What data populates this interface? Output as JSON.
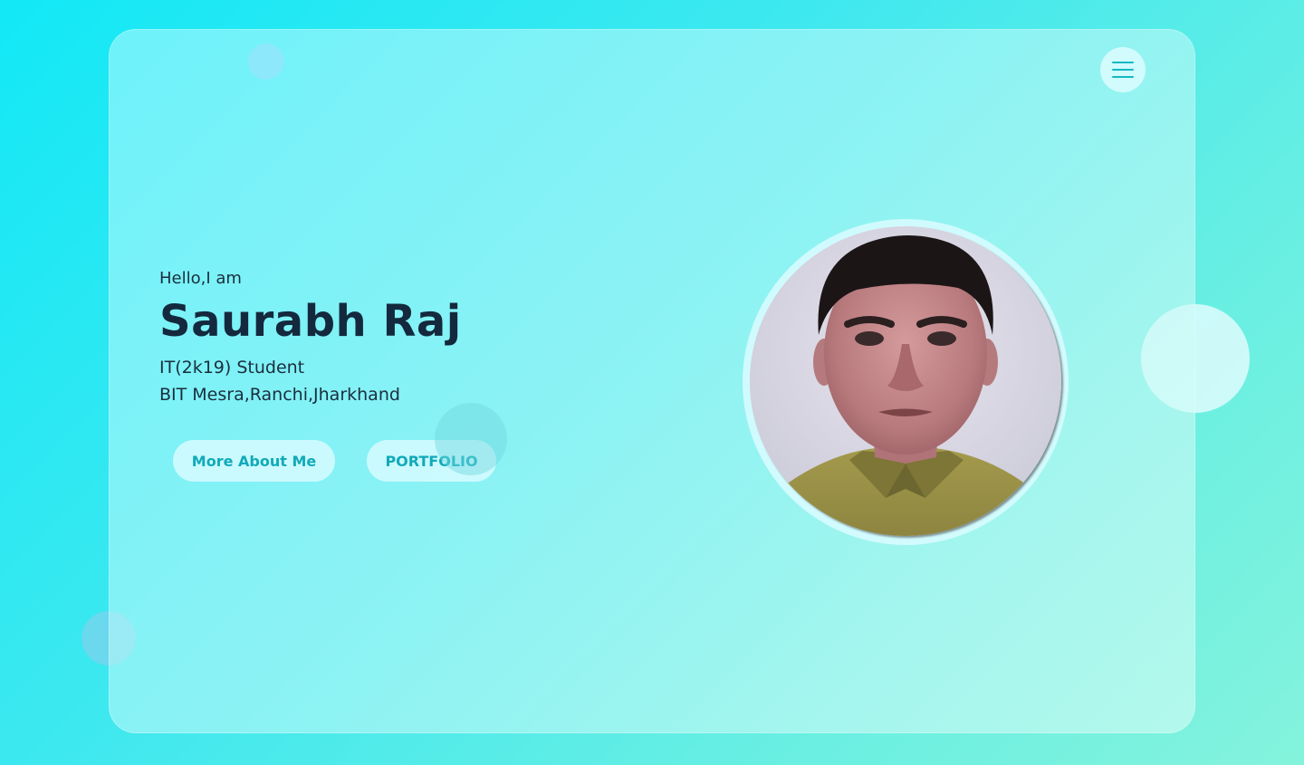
{
  "profile": {
    "greeting": "Hello,I am",
    "name": "Saurabh Raj",
    "role": "IT(2k19) Student",
    "college": "BIT Mesra,Ranchi,Jharkhand"
  },
  "buttons": {
    "about_label": "More About Me",
    "portfolio_label": "PORTFOLIO"
  },
  "icons": {
    "menu": "hamburger-menu-icon"
  },
  "colors": {
    "accent": "#12b8c4",
    "heading": "#14293d",
    "background_start": "#12e8f6",
    "background_end": "#84f3dc"
  }
}
